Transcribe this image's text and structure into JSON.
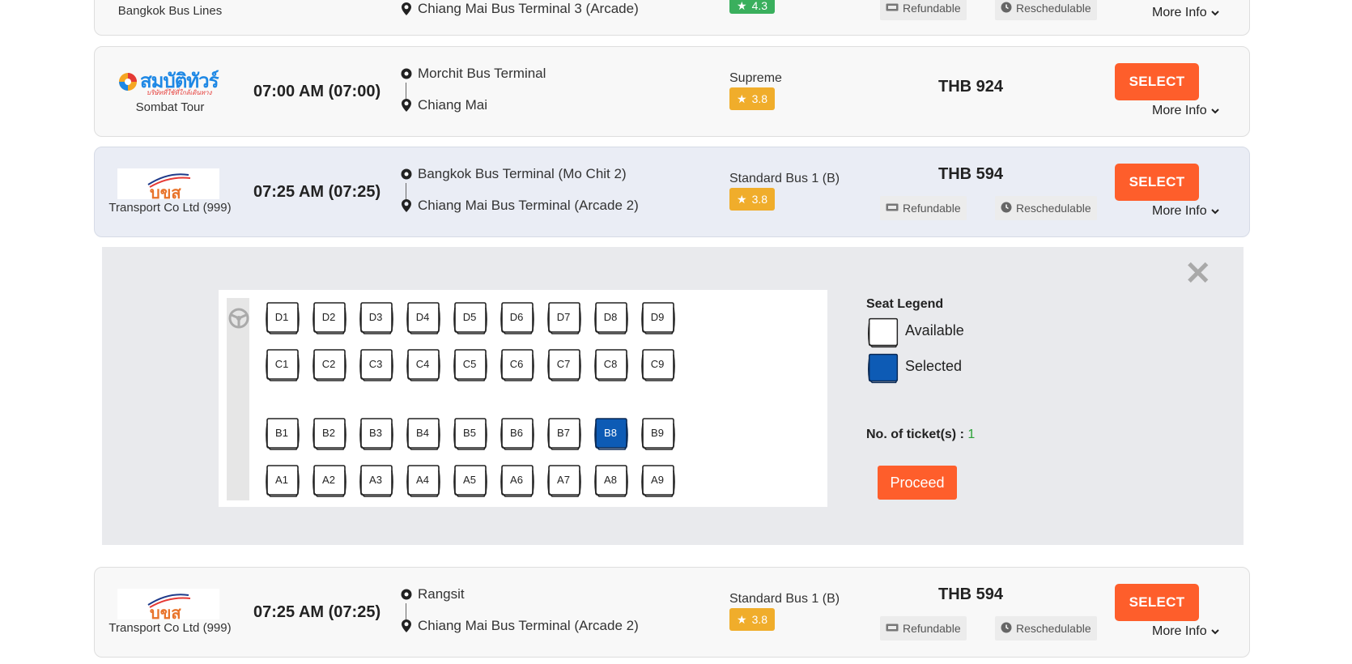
{
  "colors": {
    "accent": "#fe5e2b",
    "rating_orange": "#f0ad2b",
    "rating_green": "#3aaf5d",
    "seat_selected": "#0d5bb5",
    "ticket_count": "#2aa136"
  },
  "trips": [
    {
      "operator": "Bangkok Bus Lines",
      "time": "",
      "from": "",
      "to": "Chiang Mai Bus Terminal 3 (Arcade)",
      "bus_type": "",
      "rating": "4.3",
      "price": "",
      "refundable": "Refundable",
      "reschedulable": "Reschedulable",
      "select_label": "",
      "more_info": "More Info"
    },
    {
      "operator": "Sombat Tour",
      "logo_text": "สมบัติทัวร์",
      "logo_subtext": "บริษัทที่ใช้ที่ใกล้เดินทาง",
      "time": "07:00 AM (07:00)",
      "from": "Morchit Bus Terminal",
      "to": "Chiang Mai",
      "bus_type": "Supreme",
      "rating": "3.8",
      "price": "THB 924",
      "select_label": "SELECT",
      "more_info": "More Info"
    },
    {
      "operator": "Transport Co Ltd (999)",
      "logo_text": "บขส",
      "time": "07:25 AM (07:25)",
      "from": "Bangkok Bus Terminal (Mo Chit 2)",
      "to": "Chiang Mai Bus Terminal (Arcade 2)",
      "bus_type": "Standard Bus 1 (B)",
      "rating": "3.8",
      "price": "THB 594",
      "refundable": "Refundable",
      "reschedulable": "Reschedulable",
      "select_label": "SELECT",
      "more_info": "More Info"
    },
    {
      "operator": "Transport Co Ltd (999)",
      "logo_text": "บขส",
      "time": "07:25 AM (07:25)",
      "from": "Rangsit",
      "to": "Chiang Mai Bus Terminal (Arcade 2)",
      "bus_type": "Standard Bus 1 (B)",
      "rating": "3.8",
      "price": "THB 594",
      "refundable": "Refundable",
      "reschedulable": "Reschedulable",
      "select_label": "SELECT",
      "more_info": "More Info"
    }
  ],
  "seat_panel": {
    "rows": [
      {
        "row": "D",
        "seats": [
          "D1",
          "D2",
          "D3",
          "D4",
          "D5",
          "D6",
          "D7",
          "D8",
          "D9"
        ]
      },
      {
        "row": "C",
        "seats": [
          "C1",
          "C2",
          "C3",
          "C4",
          "C5",
          "C6",
          "C7",
          "C8",
          "C9"
        ]
      },
      {
        "row": "B",
        "seats": [
          "B1",
          "B2",
          "B3",
          "B4",
          "B5",
          "B6",
          "B7",
          "B8",
          "B9"
        ]
      },
      {
        "row": "A",
        "seats": [
          "A1",
          "A2",
          "A3",
          "A4",
          "A5",
          "A6",
          "A7",
          "A8",
          "A9"
        ]
      }
    ],
    "selected_seats": [
      "B8"
    ],
    "legend": {
      "title": "Seat Legend",
      "available": "Available",
      "selected": "Selected"
    },
    "tickets_label": "No. of ticket(s) :",
    "tickets_count": "1",
    "proceed_label": "Proceed"
  }
}
